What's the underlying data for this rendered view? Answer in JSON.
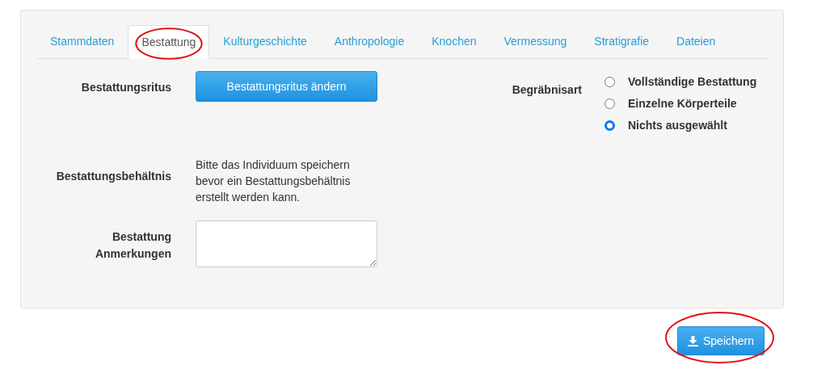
{
  "tabs": [
    {
      "label": "Stammdaten",
      "selected": false,
      "highlighted": false
    },
    {
      "label": "Bestattung",
      "selected": true,
      "highlighted": true
    },
    {
      "label": "Kulturgeschichte",
      "selected": false,
      "highlighted": false
    },
    {
      "label": "Anthropologie",
      "selected": false,
      "highlighted": false
    },
    {
      "label": "Knochen",
      "selected": false,
      "highlighted": false
    },
    {
      "label": "Vermessung",
      "selected": false,
      "highlighted": false
    },
    {
      "label": "Stratigrafie",
      "selected": false,
      "highlighted": false
    },
    {
      "label": "Dateien",
      "selected": false,
      "highlighted": false
    }
  ],
  "left_fields": [
    {
      "kind": "button",
      "label": "Bestattungsritus",
      "button": "Bestattungsritus ändern"
    },
    {
      "kind": "note",
      "label": "Bestattungsbehältnis",
      "text": "Bitte das Individuum speichern bevor ein Bestattungsbehältnis erstellt werden kann."
    },
    {
      "kind": "textarea",
      "label": "Bestattung Anmerkungen"
    }
  ],
  "burial_type": {
    "label": "Begräbnisart",
    "options": [
      {
        "label": "Vollständige Bestattung",
        "selected": false
      },
      {
        "label": "Einzelne Körperteile",
        "selected": false
      },
      {
        "label": "Nichts ausgewählt",
        "selected": true
      }
    ]
  },
  "save_button": {
    "label": "Speichern",
    "highlighted": true
  }
}
